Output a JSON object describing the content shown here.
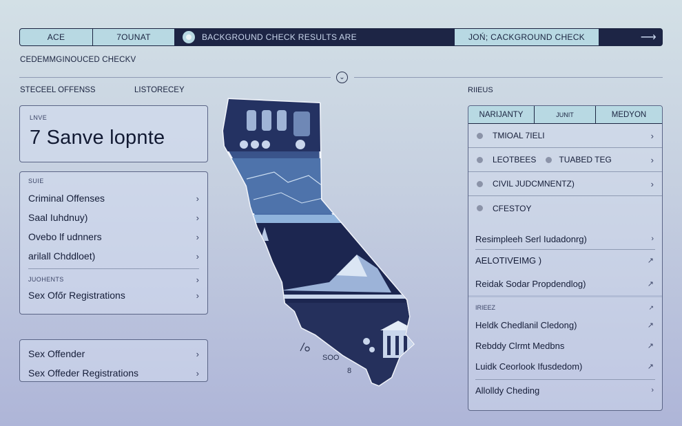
{
  "topbar": {
    "ace": "ACE",
    "count": "7OUNAT",
    "status": "BACKGROUND CHECK RESULTS ARE",
    "join": "JOŃ;   CACKGROUND CHECK",
    "arrow": "⟶"
  },
  "breadcrumb": "CEDEMMGINOUCED CHECKV",
  "labels": {
    "left": "STECEEL OFFENSS",
    "middle": "LISTORECEY",
    "right": "RIIEUS"
  },
  "hero": {
    "tag": "LNVE",
    "headline": "7 Sanve lopnte"
  },
  "list1": {
    "section": "SUIE",
    "items": [
      "Criminal Offenses",
      "Saal Iuhdnuy)",
      "Ovebo lf udnners",
      "arilall Chddloet)"
    ],
    "section2": "JUOHENTS",
    "item_last": "Sex Ofőr Registrations"
  },
  "list2": {
    "items": [
      "Sex Offender",
      "Sex Offeder Registrations"
    ]
  },
  "map": {
    "label1": "SOO",
    "label2": "8"
  },
  "results": {
    "tabs": [
      "NARIJANTY",
      "JUNIT",
      "MEDYON"
    ],
    "rows": [
      {
        "a": "TMIOAL 7IELI",
        "b": ""
      },
      {
        "a": "LEOTBEES",
        "b": "TUABED TEG"
      },
      {
        "a": "CIVIL JUDCMNENTZ)",
        "b": ""
      },
      {
        "a": "CFESTOY",
        "b": ""
      }
    ],
    "links": [
      "Resimpleeh Serl Iudadonrg)",
      "AELOTIVEIMG )",
      "Reidak Sodar Propdendlog)"
    ],
    "section": "IRIEEZ",
    "links2": [
      "Heldk Chedlanil Cledong)",
      "Rebddy Clrmt Medbns",
      "Luidk Ceorlook Ifusdedom)"
    ],
    "last": "Allolldy Cheding"
  },
  "colors": {
    "navy": "#1b2440",
    "accent": "#b8d9e3",
    "map_dark": "#1f2a52",
    "map_light": "#6f94c6"
  }
}
